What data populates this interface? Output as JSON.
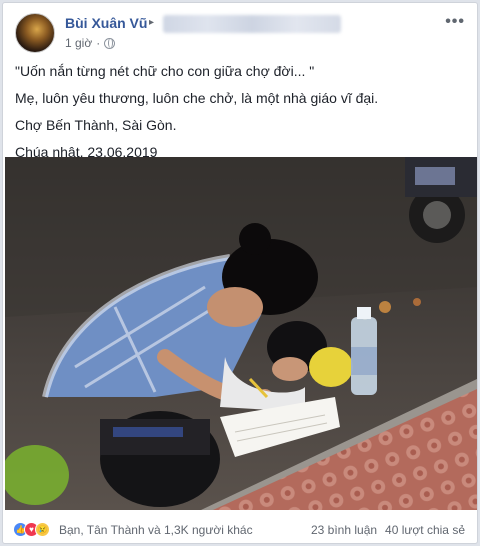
{
  "post": {
    "author": "Bùi Xuân Vũ",
    "time": "1 giờ",
    "lines": [
      "\"Uốn nắn từng nét chữ cho con giữa chợ đời... \"",
      "Mẹ, luôn yêu thương, luôn che chở, là một nhà giáo vĩ đại.",
      "Chợ Bến Thành, Sài Gòn.",
      "Chúa nhật, 23.06.2019"
    ]
  },
  "icons": {
    "caret": "▸",
    "more": "•••",
    "like": "👍",
    "love": "♥",
    "sad": "😢"
  },
  "footer": {
    "reactions_text": "Bạn, Tân Thành và 1,3K người khác",
    "comments": "23 bình luận",
    "shares": "40 lượt chia sẻ"
  }
}
